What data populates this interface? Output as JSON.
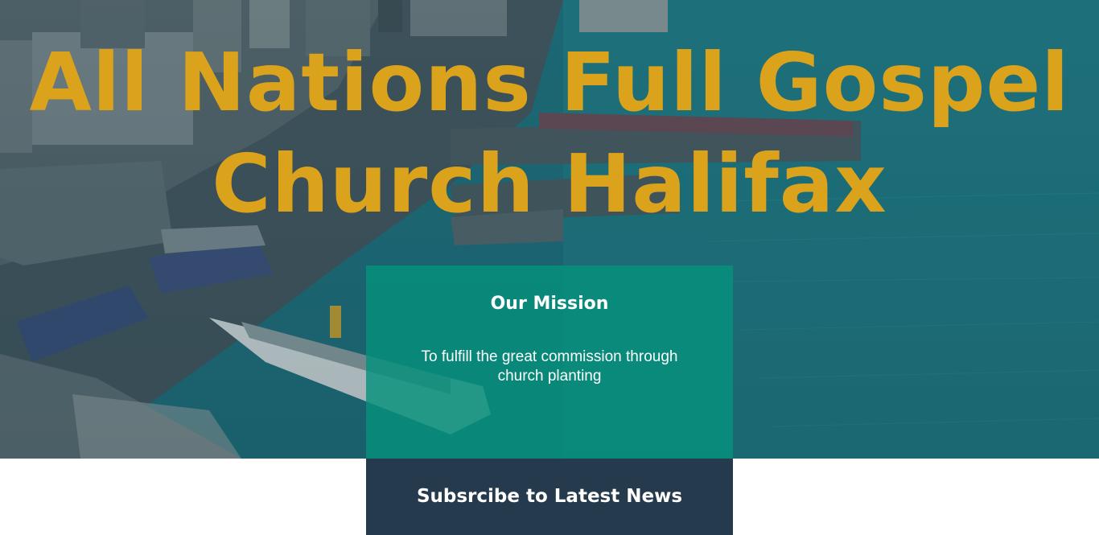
{
  "hero": {
    "title": "All Nations Full Gospel Church Halifax",
    "title_color": "#dba21c",
    "background_description_colors": {
      "water": "#1f7d86",
      "city": "#3b5360"
    }
  },
  "mission": {
    "heading": "Our Mission",
    "text": "To fulfill the great commission through church planting",
    "background_color": "#06917d"
  },
  "subscribe": {
    "heading": "Subsrcibe to Latest News",
    "background_color": "#253a4c"
  }
}
